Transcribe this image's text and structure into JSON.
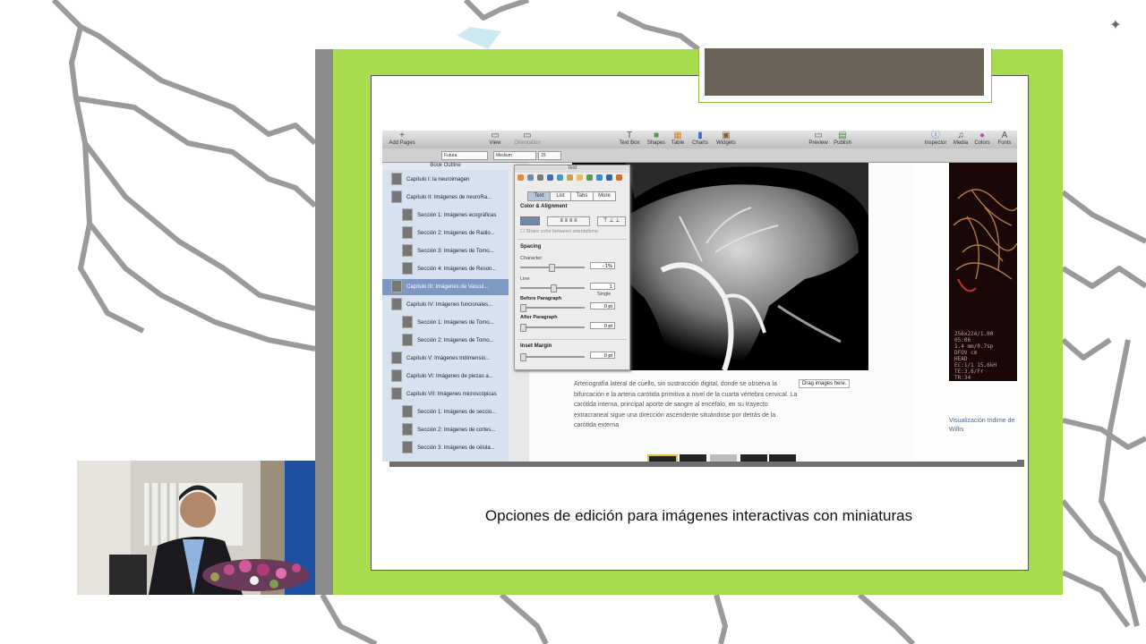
{
  "caption": "Opciones de edición para imágenes interactivas con miniaturas",
  "colors": {
    "slide_frame": "#a6dc4e",
    "title_bar": "#6b6357",
    "outline_bg": "#d6e2f0",
    "outline_selected": "#7d98c2",
    "link_text": "#3a6ea8"
  },
  "logo_icon": "sparkle-icon",
  "app": {
    "toolbar": {
      "add_pages": "Add Pages",
      "view": "View",
      "orientation": "Orientation",
      "text_box": "Text Box",
      "shapes": "Shapes",
      "table": "Table",
      "charts": "Charts",
      "widgets": "Widgets",
      "preview": "Preview",
      "publish": "Publish",
      "inspector": "Inspector",
      "media": "Media",
      "colors": "Colors",
      "fonts": "Fonts"
    },
    "format_bar": {
      "font": "Futura",
      "weight": "Medium",
      "size": "15"
    },
    "outline": {
      "header": "Book Outline",
      "items": [
        {
          "label": "Capítulo I: la neuroimagen",
          "level": 0
        },
        {
          "label": "Capítulo II: Imágenes de neuroRa...",
          "level": 0
        },
        {
          "label": "Sección 1: Imágenes ecográficas",
          "level": 1
        },
        {
          "label": "Sección 2: Imágenes de Radio...",
          "level": 1
        },
        {
          "label": "Sección 3: Imágenes de Tomo...",
          "level": 1
        },
        {
          "label": "Sección 4: Imágenes de Reson...",
          "level": 1
        },
        {
          "label": "Capítulo III: Imágenes de Vascul...",
          "level": 0,
          "selected": true
        },
        {
          "label": "Capítulo IV: Imágenes funcionales...",
          "level": 0
        },
        {
          "label": "Sección 1: Imágenes de Tomo...",
          "level": 1
        },
        {
          "label": "Sección 2: Imágenes de Tomo...",
          "level": 1
        },
        {
          "label": "Capítulo V: Imágenes tridimensio...",
          "level": 0
        },
        {
          "label": "Capítulo VI: Imágenes de piezas a...",
          "level": 0
        },
        {
          "label": "Capítulo VII: Imágenes microscópicas",
          "level": 0
        },
        {
          "label": "Sección 1: Imágenes de seccio...",
          "level": 1
        },
        {
          "label": "Sección 2: Imágenes de cortes...",
          "level": 1
        },
        {
          "label": "Sección 3: Imágenes de célula...",
          "level": 1
        }
      ]
    },
    "inspector": {
      "title": "Text",
      "tabs": [
        "Text",
        "List",
        "Tabs",
        "More"
      ],
      "color_alignment": "Color & Alignment",
      "share_color": "Share color between orientations",
      "spacing": "Spacing",
      "character": "Character",
      "character_value": "- 1%",
      "line": "Line",
      "line_value": "1",
      "line_mode": "Single",
      "before_paragraph": "Before Paragraph",
      "before_value": "0 pt",
      "after_paragraph": "After Paragraph",
      "after_value": "0 pt",
      "inset_margin": "Inset Margin",
      "inset_value": "0 pt"
    },
    "body_text": "Arteriografía lateral de cuello, sin sustracción digital, donde se observa la bifurcación e la arteria carótida primitiva a nivel de la cuarta vértebra cervical. La carótida interna, principal aporte de sangre al encéfalo, en su trayecto extracraneal sigue una dirección ascendente situándose por detrás de la carótida externa",
    "drag_tip": "Drag images here.",
    "right_caption": "Visualización tridime de Willis",
    "right_overlay": [
      "256x224/1.00",
      "05:06",
      "1.4 mm/0.7sp",
      "DFOV cm",
      "HEAD",
      "EC:1/1 15.6kH",
      "TE:3.6/Fr",
      "TR:34"
    ]
  }
}
